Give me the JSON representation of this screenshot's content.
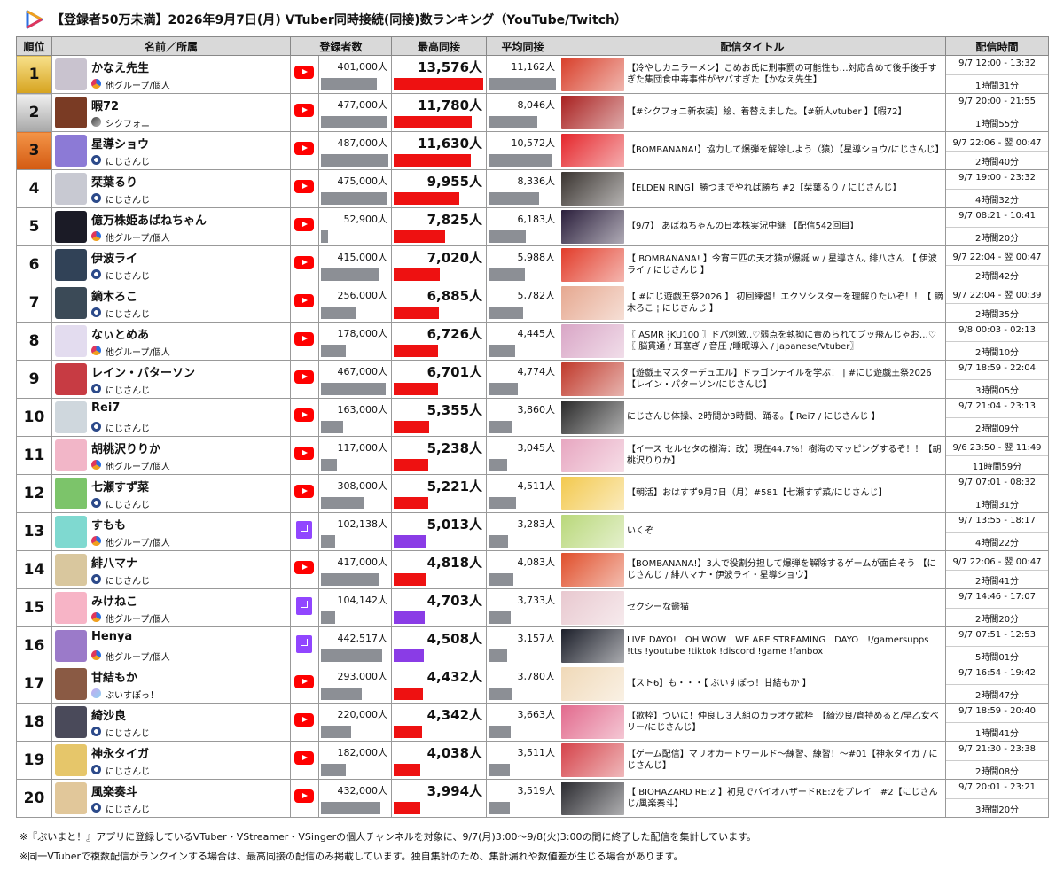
{
  "title": "【登録者50万未満】2026年9月7日(月) VTuber同時接続(同接)数ランキング（YouTube/Twitch）",
  "colors": {
    "youtube": "#ff0000",
    "twitch": "#9146ff",
    "peak_bar": "#ee1111",
    "twitch_bar": "#8a3ce6",
    "gray_bar": "#8c8f95",
    "header_bg": "#d9d9d9"
  },
  "headers": {
    "rank": "順位",
    "name": "名前／所属",
    "subscribers": "登録者数",
    "peak": "最高同接",
    "average": "平均同接",
    "stream_title": "配信タイトル",
    "stream_time": "配信時間"
  },
  "rows": [
    {
      "rank": "1",
      "name": "かなえ先生",
      "group": "他グループ/個人",
      "group_icon": "vmoto-icon",
      "platform": "youtube",
      "subs": "401,000人",
      "subs_value": 401000,
      "peak": "13,576人",
      "peak_value": 13576,
      "avg": "11,162人",
      "avg_value": 11162,
      "title": "【冷やしカニラーメン】こめお氏に刑事罰の可能性も…対応含めて後手後手すぎた集団食中毒事件がヤバすぎた【かなえ先生】",
      "date": "9/7 12:00 - 13:32",
      "duration": "1時間31分",
      "avatar": "#c9c3cf",
      "thumb": "#d83f2a"
    },
    {
      "rank": "2",
      "name": "暇72",
      "group": "シクフォニ",
      "group_icon": "sixfonia-icon",
      "platform": "youtube",
      "subs": "477,000人",
      "subs_value": 477000,
      "peak": "11,780人",
      "peak_value": 11780,
      "avg": "8,046人",
      "avg_value": 8046,
      "title": "【#シクフォニ新衣装】絵、着替えました。【#新人vtuber 】【暇72】",
      "date": "9/7 20:00 - 21:55",
      "duration": "1時間55分",
      "avatar": "#7a3b24",
      "thumb": "#a9201f"
    },
    {
      "rank": "3",
      "name": "星導ショウ",
      "group": "にじさんじ",
      "group_icon": "nijisanji-icon",
      "platform": "youtube",
      "subs": "487,000人",
      "subs_value": 487000,
      "peak": "11,630人",
      "peak_value": 11630,
      "avg": "10,572人",
      "avg_value": 10572,
      "title": "【BOMBANANA!】協力して爆弾を解除しよう（猿）【星導ショウ/にじさんじ】",
      "date": "9/7 22:06 - 翌 00:47",
      "duration": "2時間40分",
      "avatar": "#8c7ad6",
      "thumb": "#e5262b"
    },
    {
      "rank": "4",
      "name": "栞葉るり",
      "group": "にじさんじ",
      "group_icon": "nijisanji-icon",
      "platform": "youtube",
      "subs": "475,000人",
      "subs_value": 475000,
      "peak": "9,955人",
      "peak_value": 9955,
      "avg": "8,336人",
      "avg_value": 8336,
      "title": "【ELDEN RING】勝つまでやれば勝ち #2【栞葉るり / にじさんじ】",
      "date": "9/7 19:00 - 23:32",
      "duration": "4時間32分",
      "avatar": "#c8c9d2",
      "thumb": "#3a3430"
    },
    {
      "rank": "5",
      "name": "億万株姫あばねちゃん",
      "group": "他グループ/個人",
      "group_icon": "vmoto-icon",
      "platform": "youtube",
      "subs": "52,900人",
      "subs_value": 52900,
      "peak": "7,825人",
      "peak_value": 7825,
      "avg": "6,183人",
      "avg_value": 6183,
      "title": "【9/7】 あばねちゃんの日本株実況中継 【配信542回目】",
      "date": "9/7 08:21 - 10:41",
      "duration": "2時間20分",
      "avatar": "#1b1b26",
      "thumb": "#2b1f3c"
    },
    {
      "rank": "6",
      "name": "伊波ライ",
      "group": "にじさんじ",
      "group_icon": "nijisanji-icon",
      "platform": "youtube",
      "subs": "415,000人",
      "subs_value": 415000,
      "peak": "7,020人",
      "peak_value": 7020,
      "avg": "5,988人",
      "avg_value": 5988,
      "title": "【 BOMBANANA! 】今宵三匹の天才猿が爆誕 w / 星導さん, 緋八さん 【 伊波ライ / にじさんじ 】",
      "date": "9/7 22:04 - 翌 00:47",
      "duration": "2時間42分",
      "avatar": "#314257",
      "thumb": "#e23c2a"
    },
    {
      "rank": "7",
      "name": "鏑木ろこ",
      "group": "にじさんじ",
      "group_icon": "nijisanji-icon",
      "platform": "youtube",
      "subs": "256,000人",
      "subs_value": 256000,
      "peak": "6,885人",
      "peak_value": 6885,
      "avg": "5,782人",
      "avg_value": 5782,
      "title": "【 #にじ遊戯王祭2026 】 初回練習！エクソシスターを理解りたいぞ！！【 鏑木ろこ ¦ にじさんじ 】",
      "date": "9/7 22:04 - 翌 00:39",
      "duration": "2時間35分",
      "avatar": "#3b4a57",
      "thumb": "#e6a890"
    },
    {
      "rank": "8",
      "name": "なぃとめあ",
      "group": "他グループ/個人",
      "group_icon": "vmoto-icon",
      "platform": "youtube",
      "subs": "178,000人",
      "subs_value": 178000,
      "peak": "6,726人",
      "peak_value": 6726,
      "avg": "4,445人",
      "avg_value": 4445,
      "title": "〖 ASMR ⸾KU100 〗ドパ刺激‥♡弱点を執拗に責められてブッ飛んじゃお…♡ 〖 脳貫通 / 耳塞ぎ / 音圧 /睡眠導入 / Japanese/Vtuber〗",
      "date": "9/8 00:03 - 02:13",
      "duration": "2時間10分",
      "avatar": "#e3dcef",
      "thumb": "#d9a6c6"
    },
    {
      "rank": "9",
      "name": "レイン・パターソン",
      "group": "にじさんじ",
      "group_icon": "nijisanji-icon",
      "platform": "youtube",
      "subs": "467,000人",
      "subs_value": 467000,
      "peak": "6,701人",
      "peak_value": 6701,
      "avg": "4,774人",
      "avg_value": 4774,
      "title": "【遊戯王マスターデュエル】ドラゴンテイルを学ぶ！ | #にじ遊戯王祭2026 【レイン・パターソン/にじさんじ】",
      "date": "9/7 18:59 - 22:04",
      "duration": "3時間05分",
      "avatar": "#c73b43",
      "thumb": "#c0392b"
    },
    {
      "rank": "10",
      "name": "Rei7",
      "group": "にじさんじ",
      "group_icon": "nijisanji-icon",
      "platform": "youtube",
      "subs": "163,000人",
      "subs_value": 163000,
      "peak": "5,355人",
      "peak_value": 5355,
      "avg": "3,860人",
      "avg_value": 3860,
      "title": "にじさんじ体操、2時間か3時間、踊る。【 Rei7 / にじさんじ 】",
      "date": "9/7 21:04 - 23:13",
      "duration": "2時間09分",
      "avatar": "#cfd7dd",
      "thumb": "#2a2a2a"
    },
    {
      "rank": "11",
      "name": "胡桃沢りりか",
      "group": "他グループ/個人",
      "group_icon": "vmoto-icon",
      "platform": "youtube",
      "subs": "117,000人",
      "subs_value": 117000,
      "peak": "5,238人",
      "peak_value": 5238,
      "avg": "3,045人",
      "avg_value": 3045,
      "title": "【イース セルセタの樹海：改】現在44.7%！樹海のマッピングするぞ！！【胡桃沢りりか】",
      "date": "9/6 23:50 - 翌 11:49",
      "duration": "11時間59分",
      "avatar": "#f2b6c8",
      "thumb": "#e7a6c0"
    },
    {
      "rank": "12",
      "name": "七瀬すず菜",
      "group": "にじさんじ",
      "group_icon": "nijisanji-icon",
      "platform": "youtube",
      "subs": "308,000人",
      "subs_value": 308000,
      "peak": "5,221人",
      "peak_value": 5221,
      "avg": "4,511人",
      "avg_value": 4511,
      "title": "【朝活】おはすず9月7日（月）#581【七瀬すず菜/にじさんじ】",
      "date": "9/7 07:01 - 08:32",
      "duration": "1時間31分",
      "avatar": "#7cc46a",
      "thumb": "#f3c94e"
    },
    {
      "rank": "13",
      "name": "すもも",
      "group": "他グループ/個人",
      "group_icon": "vmoto-icon",
      "platform": "twitch",
      "subs": "102,138人",
      "subs_value": 102138,
      "peak": "5,013人",
      "peak_value": 5013,
      "avg": "3,283人",
      "avg_value": 3283,
      "title": "いくぞ",
      "date": "9/7 13:55 - 18:17",
      "duration": "4時間22分",
      "avatar": "#7fd9d0",
      "thumb": "#b9d87a"
    },
    {
      "rank": "14",
      "name": "緋八マナ",
      "group": "にじさんじ",
      "group_icon": "nijisanji-icon",
      "platform": "youtube",
      "subs": "417,000人",
      "subs_value": 417000,
      "peak": "4,818人",
      "peak_value": 4818,
      "avg": "4,083人",
      "avg_value": 4083,
      "title": "【BOMBANANA!】3人で役割分担して爆弾を解除するゲームが面白そう 【にじさんじ / 緋八マナ・伊波ライ・星導ショウ】",
      "date": "9/7 22:06 - 翌 00:47",
      "duration": "2時間41分",
      "avatar": "#d9c79e",
      "thumb": "#e04f2b"
    },
    {
      "rank": "15",
      "name": "みけねこ",
      "group": "他グループ/個人",
      "group_icon": "vmoto-icon",
      "platform": "twitch",
      "subs": "104,142人",
      "subs_value": 104142,
      "peak": "4,703人",
      "peak_value": 4703,
      "avg": "3,733人",
      "avg_value": 3733,
      "title": "セクシーな鬱猫",
      "date": "9/7 14:46 - 17:07",
      "duration": "2時間20分",
      "avatar": "#f7b4c6",
      "thumb": "#e8c8cf"
    },
    {
      "rank": "16",
      "name": "Henya",
      "group": "他グループ/個人",
      "group_icon": "vmoto-icon",
      "platform": "twitch",
      "subs": "442,517人",
      "subs_value": 442517,
      "peak": "4,508人",
      "peak_value": 4508,
      "avg": "3,157人",
      "avg_value": 3157,
      "title": "LIVE DAYO!　OH WOW　WE ARE STREAMING　DAYO　!/gamersupps !tts !youtube !tiktok !discord !game !fanbox",
      "date": "9/7 07:51 - 12:53",
      "duration": "5時間01分",
      "avatar": "#9b7ac9",
      "thumb": "#1c1f2a"
    },
    {
      "rank": "17",
      "name": "甘結もか",
      "group": "ぶいすぽっ！",
      "group_icon": "vspo-icon",
      "platform": "youtube",
      "subs": "293,000人",
      "subs_value": 293000,
      "peak": "4,432人",
      "peak_value": 4432,
      "avg": "3,780人",
      "avg_value": 3780,
      "title": "【スト6】も・・・【 ぶいすぽっ！甘結もか 】",
      "date": "9/7 16:54 - 19:42",
      "duration": "2時間47分",
      "avatar": "#8a5a44",
      "thumb": "#f0d9b8"
    },
    {
      "rank": "18",
      "name": "綺沙良",
      "group": "にじさんじ",
      "group_icon": "nijisanji-icon",
      "platform": "youtube",
      "subs": "220,000人",
      "subs_value": 220000,
      "peak": "4,342人",
      "peak_value": 4342,
      "avg": "3,663人",
      "avg_value": 3663,
      "title": "【歌枠】ついに！仲良し３人組のカラオケ歌枠　【綺沙良/倉持めると/早乙女ベリー/にじさんじ】",
      "date": "9/7 18:59 - 20:40",
      "duration": "1時間41分",
      "avatar": "#4a4a5a",
      "thumb": "#e26a8d"
    },
    {
      "rank": "19",
      "name": "神永タイガ",
      "group": "にじさんじ",
      "group_icon": "nijisanji-icon",
      "platform": "youtube",
      "subs": "182,000人",
      "subs_value": 182000,
      "peak": "4,038人",
      "peak_value": 4038,
      "avg": "3,511人",
      "avg_value": 3511,
      "title": "【ゲーム配信】マリオカートワールド～練習、練習！～#01【神永タイガ / にじさんじ】",
      "date": "9/7 21:30 - 23:38",
      "duration": "2時間08分",
      "avatar": "#e6c66a",
      "thumb": "#d5434a"
    },
    {
      "rank": "20",
      "name": "風楽奏斗",
      "group": "にじさんじ",
      "group_icon": "nijisanji-icon",
      "platform": "youtube",
      "subs": "432,000人",
      "subs_value": 432000,
      "peak": "3,994人",
      "peak_value": 3994,
      "avg": "3,519人",
      "avg_value": 3519,
      "title": "【 BIOHAZARD RE:2 】初見でバイオハザードRE:2をプレイ　#2【にじさんじ/風楽奏斗】",
      "date": "9/7 20:01 - 23:21",
      "duration": "3時間20分",
      "avatar": "#e1c79a",
      "thumb": "#2b2b30"
    }
  ],
  "footnotes": [
    "※『ぶいまと！』アプリに登録しているVTuber・VStreamer・VSingerの個人チャンネルを対象に、9/7(月)3:00～9/8(火)3:00の間に終了した配信を集計しています。",
    "※同一VTuberで複数配信がランクインする場合は、最高同接の配信のみ掲載しています。独自集計のため、集計漏れや数値差が生じる場合があります。"
  ]
}
